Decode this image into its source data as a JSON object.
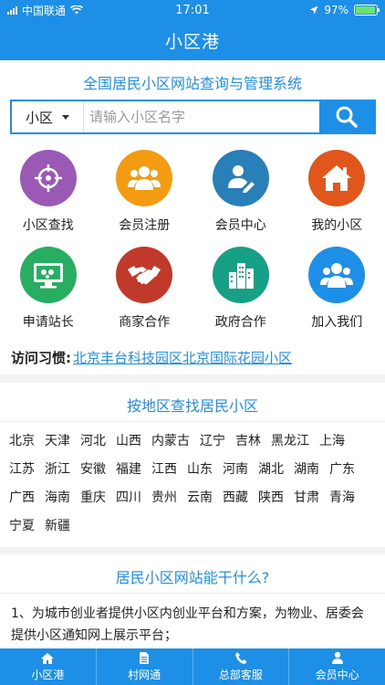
{
  "status": {
    "carrier": "中国联通",
    "time": "17:01",
    "battery": "97%",
    "battery_level": 0.97
  },
  "nav": {
    "title": "小区港"
  },
  "header": {
    "subtitle": "全国居民小区网站查询与管理系统"
  },
  "search": {
    "select_value": "小区",
    "placeholder": "请输入小区名字"
  },
  "grid": [
    {
      "label": "小区查找",
      "icon": "crosshair-icon",
      "color": "#9b59b6"
    },
    {
      "label": "会员注册",
      "icon": "users-icon",
      "color": "#f39c12"
    },
    {
      "label": "会员中心",
      "icon": "user-edit-icon",
      "color": "#2980b9"
    },
    {
      "label": "我的小区",
      "icon": "home-icon",
      "color": "#e0561b"
    },
    {
      "label": "申请站长",
      "icon": "monitor-icon",
      "color": "#27ae60"
    },
    {
      "label": "商家合作",
      "icon": "handshake-icon",
      "color": "#c0392b"
    },
    {
      "label": "政府合作",
      "icon": "buildings-icon",
      "color": "#16a085"
    },
    {
      "label": "加入我们",
      "icon": "group-icon",
      "color": "#1e8fe6"
    }
  ],
  "visit": {
    "label": "访问习惯:",
    "links": [
      "北京丰台科技园区",
      "北京国际花园小区"
    ]
  },
  "regions": {
    "title": "按地区查找居民小区",
    "items": [
      "北京",
      "天津",
      "河北",
      "山西",
      "内蒙古",
      "辽宁",
      "吉林",
      "黑龙江",
      "上海",
      "江苏",
      "浙江",
      "安徽",
      "福建",
      "江西",
      "山东",
      "河南",
      "湖北",
      "湖南",
      "广东",
      "广西",
      "海南",
      "重庆",
      "四川",
      "贵州",
      "云南",
      "西藏",
      "陕西",
      "甘肃",
      "青海",
      "宁夏",
      "新疆"
    ]
  },
  "about": {
    "title": "居民小区网站能干什么?",
    "text": "1、为城市创业者提供小区内创业平台和方案，为物业、居委会提供小区通知网上展示平台；"
  },
  "tabbar": [
    {
      "label": "小区港",
      "icon": "home-icon"
    },
    {
      "label": "村网通",
      "icon": "document-icon"
    },
    {
      "label": "总部客服",
      "icon": "phone-icon"
    },
    {
      "label": "会员中心",
      "icon": "user-icon"
    }
  ],
  "colors": {
    "primary": "#1e8fe6"
  }
}
